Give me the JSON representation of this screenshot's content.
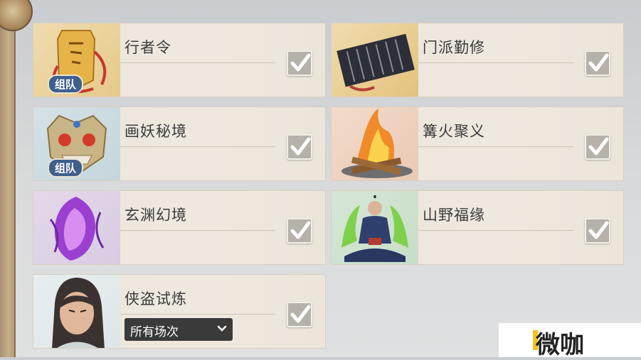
{
  "activities": [
    {
      "name": "行者令",
      "badge": "组队",
      "icon": "token-icon"
    },
    {
      "name": "门派勤修",
      "icon": "scroll-icon"
    },
    {
      "name": "画妖秘境",
      "badge": "组队",
      "icon": "demon-mask-icon"
    },
    {
      "name": "篝火聚义",
      "icon": "bonfire-icon"
    },
    {
      "name": "玄渊幻境",
      "icon": "purple-crystal-icon"
    },
    {
      "name": "山野福缘",
      "icon": "meditating-monk-icon"
    },
    {
      "name": "侠盗试炼",
      "icon": "swordsman-portrait-icon",
      "dropdown": "所有场次"
    }
  ],
  "watermark": "微咖",
  "colors": {
    "card_bg": "#ece6dc",
    "badge_bg": "#3f5f8c",
    "check_bg": "#b7b2a9",
    "dropdown_bg": "#3a3a3a",
    "watermark_accent": "#f3c21b"
  }
}
